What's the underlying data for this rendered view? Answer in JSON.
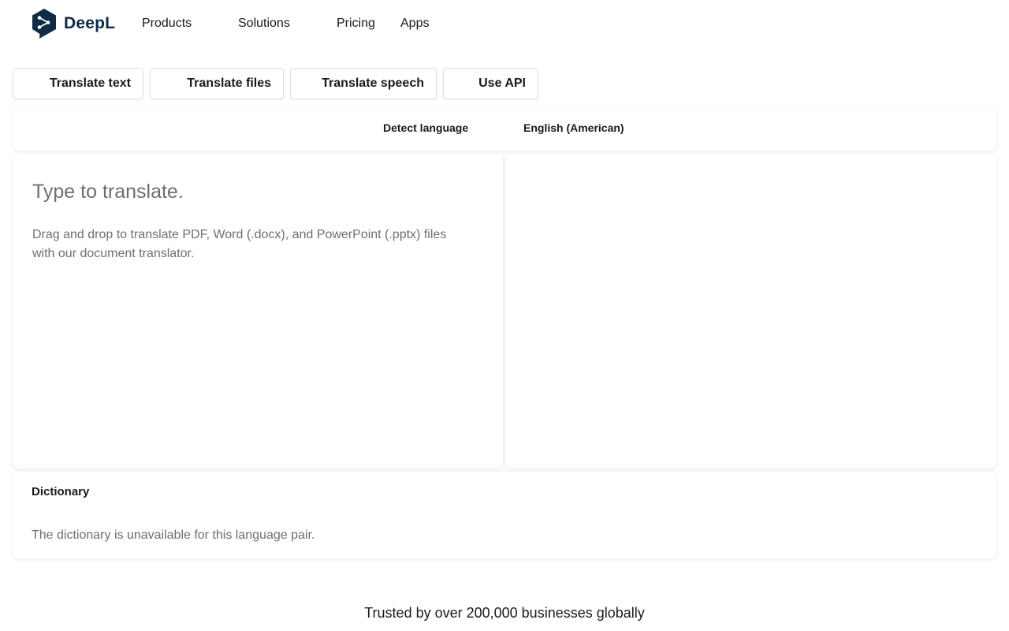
{
  "brand": {
    "name": "DeepL",
    "color": "#0f2b46"
  },
  "nav": {
    "items": [
      "Products",
      "Solutions",
      "Pricing",
      "Apps"
    ]
  },
  "tabs": [
    {
      "label": "Translate text"
    },
    {
      "label": "Translate files"
    },
    {
      "label": "Translate speech"
    },
    {
      "label": "Use API"
    }
  ],
  "languages": {
    "source": "Detect language",
    "target": "English (American)"
  },
  "source_panel": {
    "placeholder": "Type to translate.",
    "value": "",
    "hint": "Drag and drop to translate PDF, Word (.docx), and PowerPoint (.pptx) files with our document translator."
  },
  "target_panel": {
    "text": ""
  },
  "dictionary": {
    "title": "Dictionary",
    "message": "The dictionary is unavailable for this language pair."
  },
  "footer": {
    "tagline": "Trusted by over 200,000 businesses globally"
  }
}
